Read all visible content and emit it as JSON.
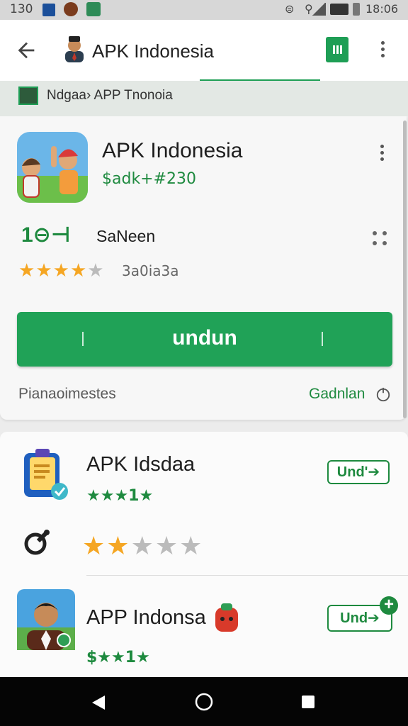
{
  "status_bar": {
    "time_left": "130",
    "time_right": "18:06"
  },
  "app_bar": {
    "title": "APK Indonesia"
  },
  "breadcrumb": {
    "text": "Ndgaa› APP Tnonoia"
  },
  "main_card": {
    "app_name": "APK Indonesia",
    "tag": "$adk+#230",
    "size_num": "1⊖⊣",
    "size_label": "SaNeen",
    "rating": {
      "filled": 4,
      "total": 5,
      "count": "3a0ia3a"
    },
    "install_label": "undun",
    "footer_left": "Pianaoimestes",
    "footer_right": "Gadnlan",
    "colors": {
      "accent": "#20a257",
      "star": "#f5a623"
    }
  },
  "list": [
    {
      "title": "APK Idsdaa",
      "stars_text": "★★★1★",
      "button": "Und'➔",
      "icon": "clipboard-app-icon"
    },
    {
      "title": "APP Indonsa",
      "stars_text": "$★★1★",
      "button": "Und➔",
      "icon": "man-portrait-app-icon"
    }
  ],
  "row2_rating": {
    "filled": 2,
    "total": 5
  }
}
